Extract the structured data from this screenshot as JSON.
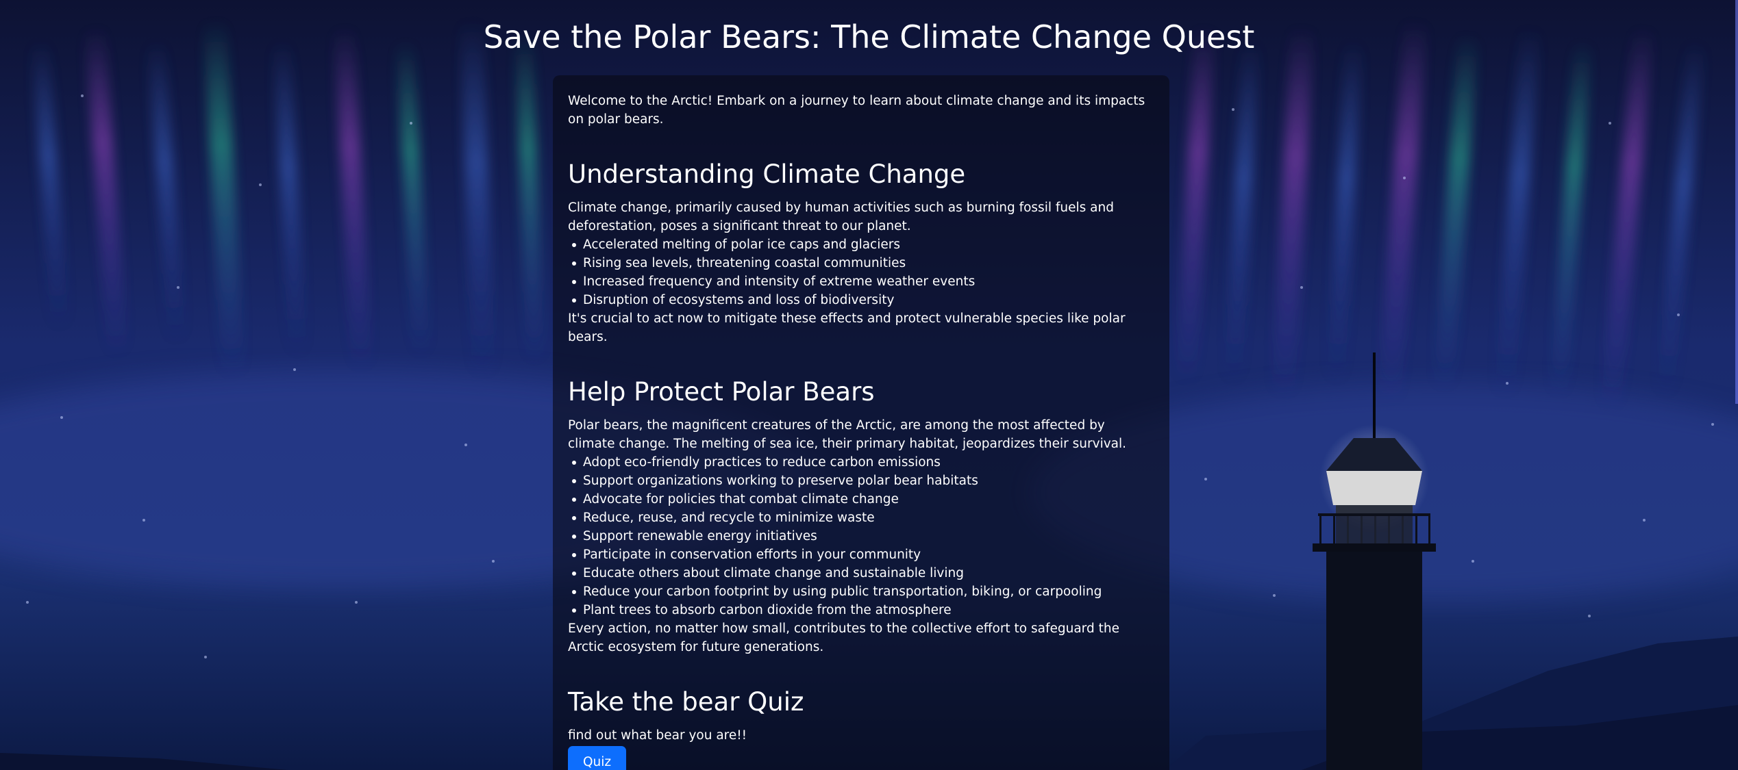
{
  "page": {
    "title": "Save the Polar Bears: The Climate Change Quest"
  },
  "intro": "Welcome to the Arctic! Embark on a journey to learn about climate change and its impacts on polar bears.",
  "climate": {
    "heading": "Understanding Climate Change",
    "text": "Climate change, primarily caused by human activities such as burning fossil fuels and deforestation, poses a significant threat to our planet.",
    "items": [
      "Accelerated melting of polar ice caps and glaciers",
      "Rising sea levels, threatening coastal communities",
      "Increased frequency and intensity of extreme weather events",
      "Disruption of ecosystems and loss of biodiversity"
    ],
    "closing": "It's crucial to act now to mitigate these effects and protect vulnerable species like polar bears."
  },
  "protect": {
    "heading": "Help Protect Polar Bears",
    "text": "Polar bears, the magnificent creatures of the Arctic, are among the most affected by climate change. The melting of sea ice, their primary habitat, jeopardizes their survival.",
    "items": [
      "Adopt eco-friendly practices to reduce carbon emissions",
      "Support organizations working to preserve polar bear habitats",
      "Advocate for policies that combat climate change",
      "Reduce, reuse, and recycle to minimize waste",
      "Support renewable energy initiatives",
      "Participate in conservation efforts in your community",
      "Educate others about climate change and sustainable living",
      "Reduce your carbon footprint by using public transportation, biking, or carpooling",
      "Plant trees to absorb carbon dioxide from the atmosphere"
    ],
    "closing": "Every action, no matter how small, contributes to the collective effort to safeguard the Arctic ecosystem for future generations."
  },
  "quiz": {
    "heading": "Take the bear Quiz",
    "text": "find out what bear you are!!",
    "button_label": "Quiz"
  },
  "colors": {
    "accent": "#0d6efd",
    "sky_top": "#0c1430",
    "aurora_green": "#2fd3a0",
    "aurora_purple": "#b04bd8"
  }
}
